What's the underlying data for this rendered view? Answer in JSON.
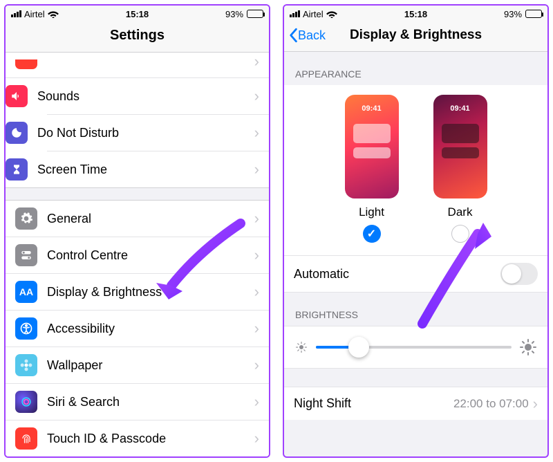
{
  "status": {
    "carrier": "Airtel",
    "time": "15:18",
    "battery_pct": "93%"
  },
  "left": {
    "title": "Settings",
    "rows": {
      "sounds": "Sounds",
      "dnd": "Do Not Disturb",
      "screentime": "Screen Time",
      "general": "General",
      "control": "Control Centre",
      "display": "Display & Brightness",
      "accessibility": "Accessibility",
      "wallpaper": "Wallpaper",
      "siri": "Siri & Search",
      "touchid": "Touch ID & Passcode"
    }
  },
  "right": {
    "back": "Back",
    "title": "Display & Brightness",
    "appearance_header": "APPEARANCE",
    "preview_time": "09:41",
    "light_label": "Light",
    "dark_label": "Dark",
    "automatic": "Automatic",
    "brightness_header": "BRIGHTNESS",
    "nightshift": "Night Shift",
    "nightshift_detail": "22:00 to 07:00"
  }
}
